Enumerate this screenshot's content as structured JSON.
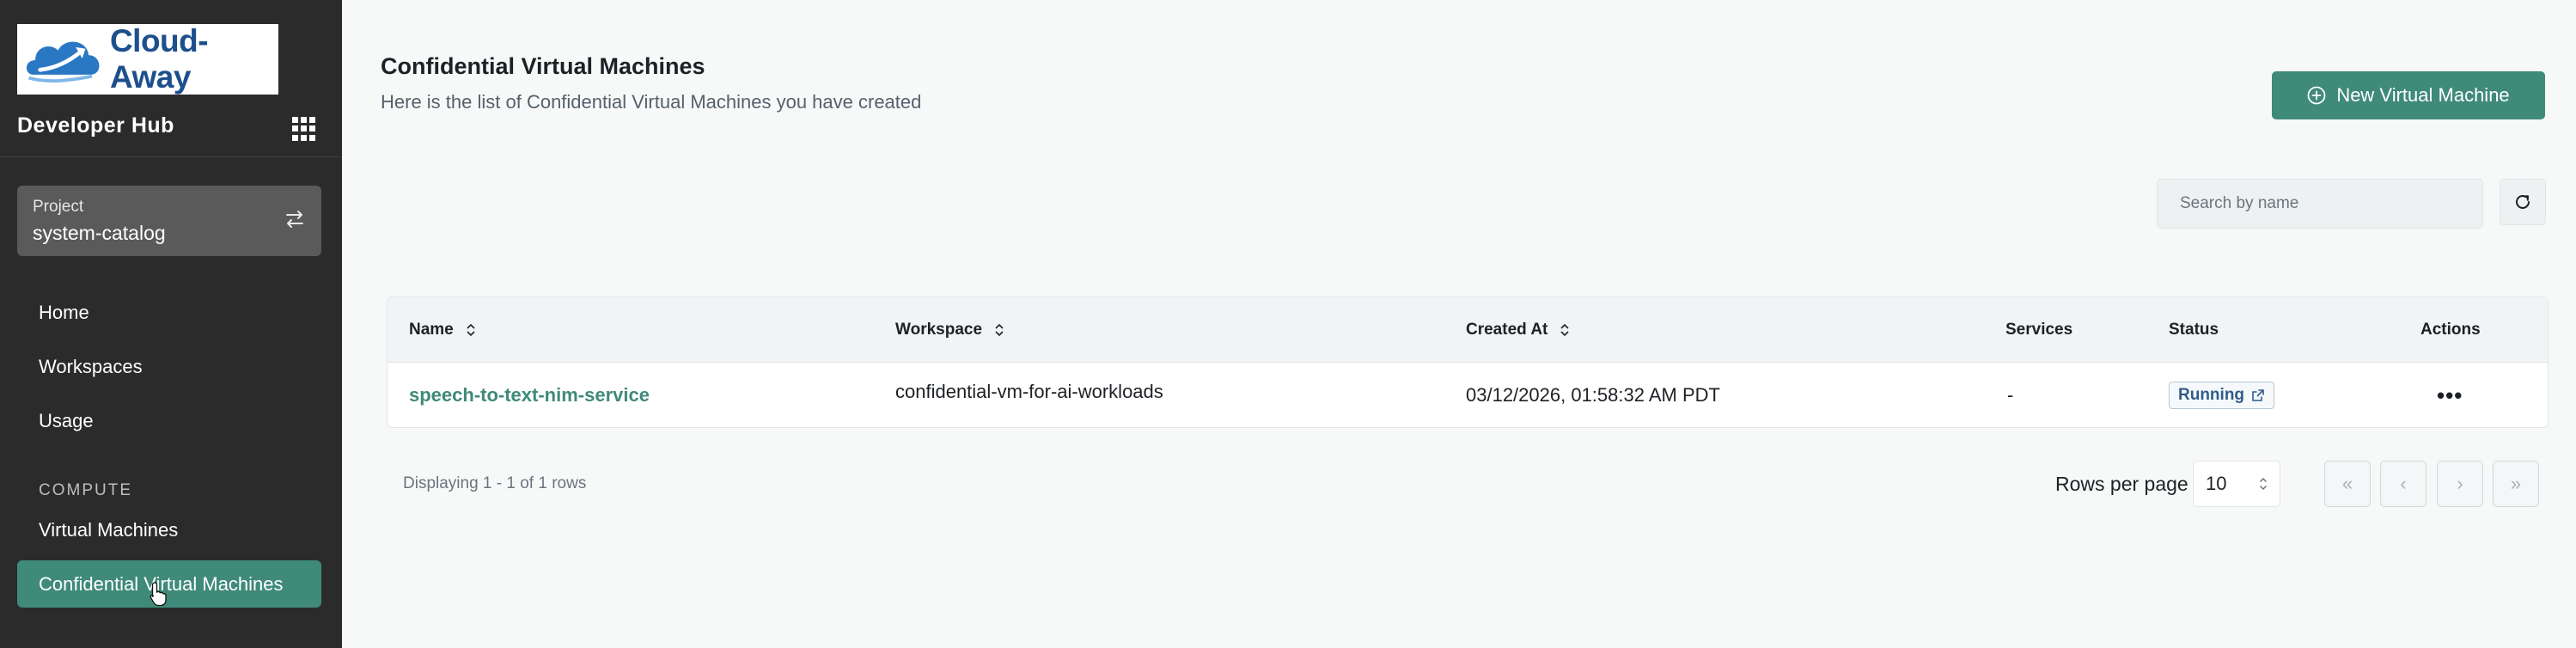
{
  "brand": {
    "name": "Cloud-Away",
    "accent": "#3f8a78",
    "sidebar_bg": "#2b2b2b"
  },
  "sidebar": {
    "hub_title": "Developer Hub",
    "project": {
      "label": "Project",
      "value": "system-catalog"
    },
    "nav": [
      {
        "label": "Home"
      },
      {
        "label": "Workspaces"
      },
      {
        "label": "Usage"
      }
    ],
    "section_compute": "COMPUTE",
    "compute_items": [
      {
        "label": "Virtual Machines"
      },
      {
        "label": "Confidential Virtual Machines",
        "active": true
      }
    ]
  },
  "header": {
    "title": "Confidential Virtual Machines",
    "subtitle": "Here is the list of Confidential Virtual Machines you have created",
    "new_button": "New Virtual Machine"
  },
  "search": {
    "placeholder": "Search by name",
    "value": ""
  },
  "table": {
    "columns": [
      "Name",
      "Workspace",
      "Created At",
      "Services",
      "Status",
      "Actions"
    ],
    "rows": [
      {
        "name": "speech-to-text-nim-service",
        "workspace": "confidential-vm-for-ai-workloads",
        "created_at": "03/12/2026, 01:58:32 AM PDT",
        "services": "-",
        "status": "Running",
        "actions": "•••"
      }
    ]
  },
  "footer": {
    "display_text": "Displaying 1 - 1 of 1 rows",
    "rows_per_page_label": "Rows per page",
    "rows_per_page_value": "10",
    "pager": {
      "first": "«",
      "prev": "‹",
      "next": "›",
      "last": "»"
    }
  },
  "icons": [
    "apps-grid-icon",
    "swap-icon",
    "plus-circle-icon",
    "refresh-icon",
    "sort-icon",
    "external-link-icon",
    "pointer-cursor-icon"
  ]
}
